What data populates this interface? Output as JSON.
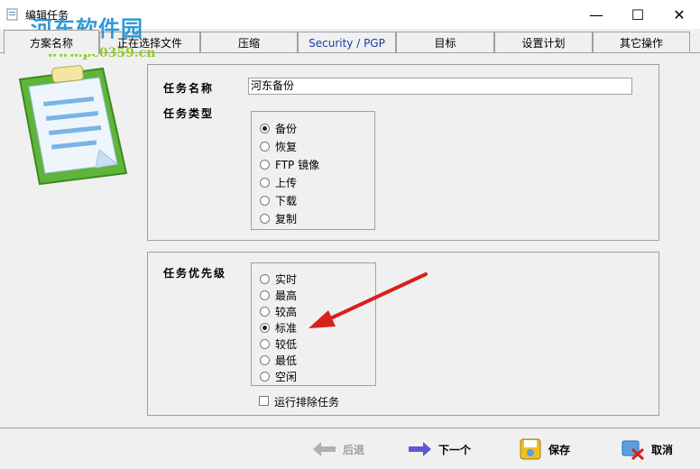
{
  "window": {
    "title": "编辑任务",
    "controls": {
      "minimize": "—",
      "maximize": "☐",
      "close": "✕"
    }
  },
  "watermark": {
    "logo_text": "河东软件园",
    "url": "www.pc0359.cn"
  },
  "tabs": [
    {
      "label": "方案名称",
      "active": true
    },
    {
      "label": "正在选择文件"
    },
    {
      "label": "压缩"
    },
    {
      "label": "Security / PGP"
    },
    {
      "label": "目标"
    },
    {
      "label": "设置计划"
    },
    {
      "label": "其它操作"
    }
  ],
  "task": {
    "name_label": "任务名称",
    "name_value": "河东备份",
    "type_label": "任务类型",
    "types": [
      {
        "label": "备份",
        "selected": true
      },
      {
        "label": "恢复"
      },
      {
        "label": "FTP 镜像"
      },
      {
        "label": "上传"
      },
      {
        "label": "下载"
      },
      {
        "label": "复制"
      }
    ],
    "priority_label": "任务优先级",
    "priorities": [
      {
        "label": "实时"
      },
      {
        "label": "最高"
      },
      {
        "label": "较高"
      },
      {
        "label": "标准",
        "selected": true
      },
      {
        "label": "较低"
      },
      {
        "label": "最低"
      },
      {
        "label": "空闲"
      }
    ],
    "exclusive_label": "运行排除任务",
    "exclusive_checked": false
  },
  "buttons": {
    "back": "后退",
    "next": "下一个",
    "save": "保存",
    "cancel": "取消"
  },
  "colors": {
    "accent_arrow": "#d8201c",
    "security_tab": "#1a3aa8"
  }
}
